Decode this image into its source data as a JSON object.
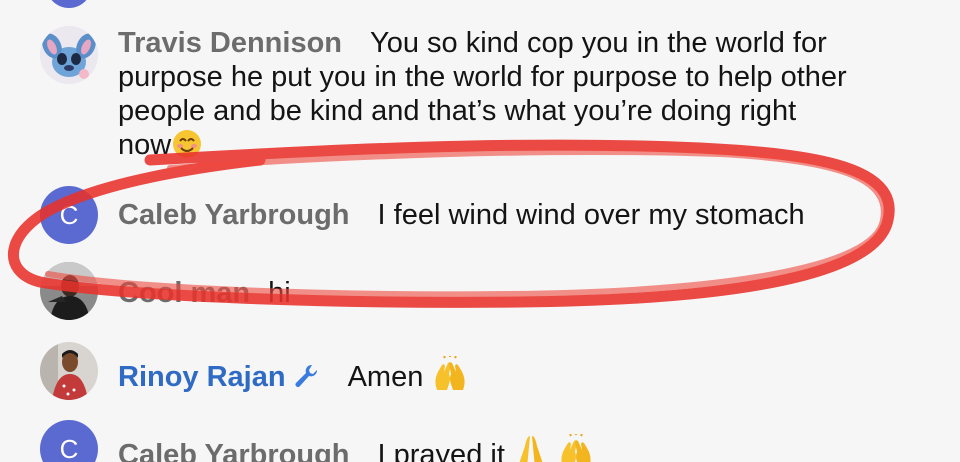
{
  "messages": [
    {
      "author": "Travis Dennison",
      "text_lines": [
        "You so kind cop you in the world for",
        "purpose he put you in the world for purpose to help other",
        "people and be kind and that’s what you’re doing right",
        "now"
      ],
      "emoji": "smiling-face-icon"
    },
    {
      "author": "Caleb Yarbrough",
      "avatar_letter": "C",
      "text": "I feel wind wind over my stomach"
    },
    {
      "author": "Cool man",
      "text": "hi"
    },
    {
      "author": "Rinoy Rajan",
      "text": "Amen",
      "emoji": "raising-hands-icon"
    },
    {
      "author": "Caleb Yarbrough",
      "avatar_letter": "C",
      "text": "I prayed it",
      "emojis": [
        "folded-hands-icon",
        "raising-hands-icon"
      ]
    }
  ],
  "colors": {
    "background": "#f6f6f6",
    "author_gray": "#6c6c6c",
    "moderator_blue": "#2f6ac4",
    "avatar_purple": "#5b6ad0",
    "scribble_red": "#e8312b"
  }
}
